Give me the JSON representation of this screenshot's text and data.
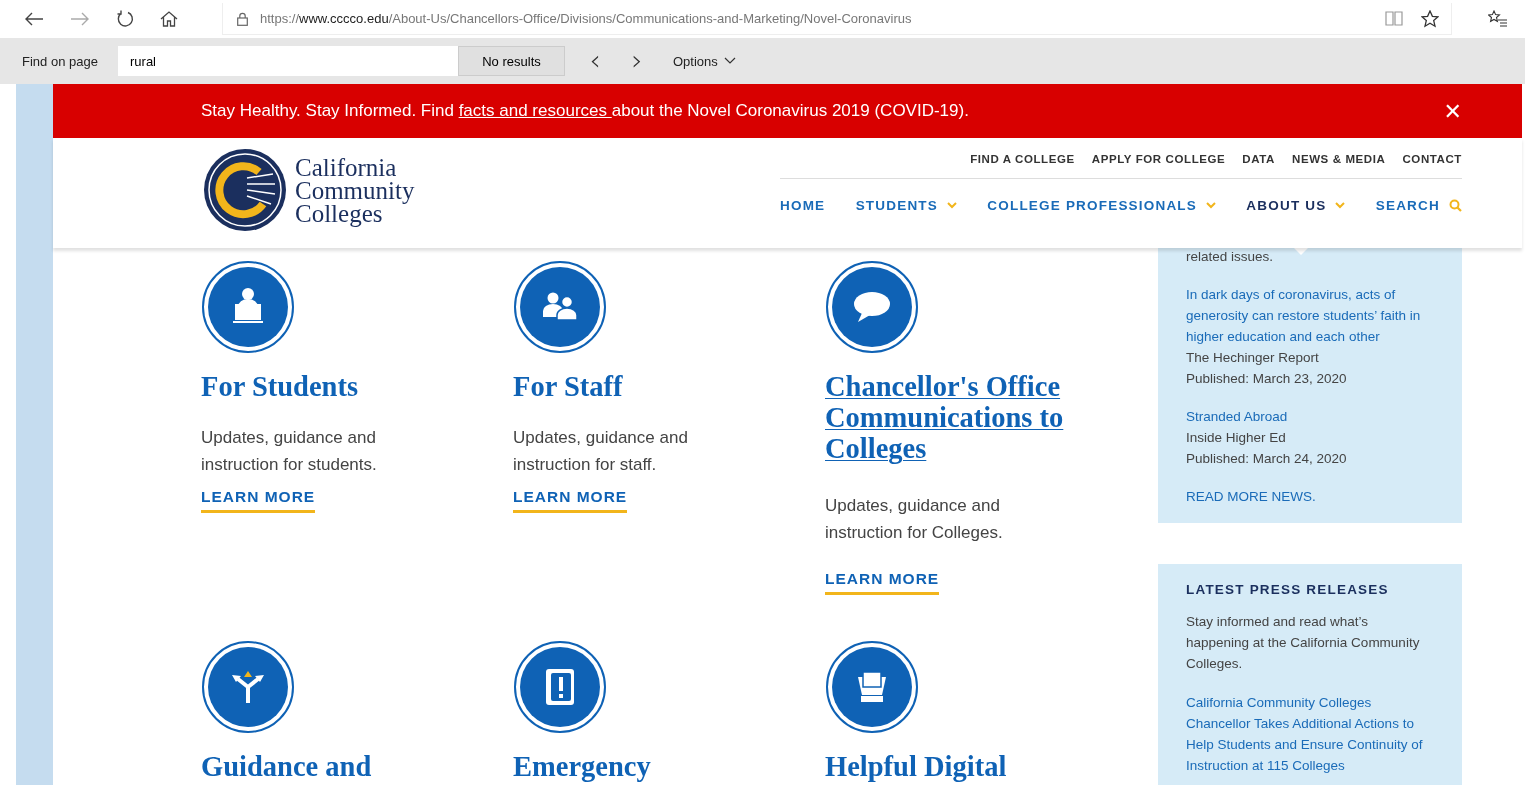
{
  "browser": {
    "url": {
      "scheme": "https://",
      "host": "www.cccco.edu",
      "path": "/About-Us/Chancellors-Office/Divisions/Communications-and-Marketing/Novel-Coronavirus"
    }
  },
  "find_bar": {
    "label": "Find on page",
    "value": "rural",
    "result": "No results",
    "prev": "‹",
    "next": "›",
    "options": "Options"
  },
  "banner": {
    "before": "Stay Healthy. Stay Informed. Find ",
    "link": "facts and resources ",
    "after": "about the Novel Coronavirus 2019 (COVID-19).",
    "close": "✕"
  },
  "logo": {
    "lines": [
      "California",
      "Community",
      "Colleges"
    ]
  },
  "top_links": [
    "FIND A COLLEGE",
    "APPLY FOR COLLEGE",
    "DATA",
    "NEWS & MEDIA",
    "CONTACT"
  ],
  "main_nav": [
    {
      "label": "HOME",
      "has_menu": false,
      "selected": false
    },
    {
      "label": "STUDENTS",
      "has_menu": true,
      "selected": false
    },
    {
      "label": "COLLEGE PROFESSIONALS",
      "has_menu": true,
      "selected": false
    },
    {
      "label": "ABOUT US",
      "has_menu": true,
      "selected": true
    },
    {
      "label": "SEARCH",
      "has_menu": false,
      "selected": false,
      "kind": "search"
    }
  ],
  "cards": [
    {
      "title": "For Students",
      "linked": false,
      "description": "Updates, guidance and instruction for students.",
      "action": "LEARN MORE"
    },
    {
      "title": "For Staff",
      "linked": false,
      "description": "Updates, guidance and instruction for staff.",
      "action": "LEARN MORE"
    },
    {
      "title": "Chancellor's Office Communications to Colleges",
      "linked": true,
      "description": "Updates, guidance and instruction for Colleges.",
      "action": "LEARN MORE"
    },
    {
      "title": "Guidance and",
      "linked": false
    },
    {
      "title": "Emergency",
      "linked": false
    },
    {
      "title": "Helpful Digital",
      "linked": false
    }
  ],
  "news": {
    "cut_text": "related issues.",
    "items": [
      {
        "title": "In dark days of coronavirus, acts of generosity can restore students’ faith in higher education and each other",
        "source": "The Hechinger Report",
        "date": "Published: March 23, 2020"
      },
      {
        "title": "Stranded Abroad",
        "source": "Inside Higher Ed",
        "date": "Published: March 24, 2020"
      }
    ],
    "more": "READ MORE NEWS."
  },
  "press": {
    "heading": "LATEST PRESS RELEASES",
    "intro": "Stay informed and read what’s happening at the California Community Colleges.",
    "items": [
      "California Community Colleges Chancellor Takes Additional Actions to Help Students and Ensure Continuity of Instruction at 115 Colleges"
    ]
  }
}
